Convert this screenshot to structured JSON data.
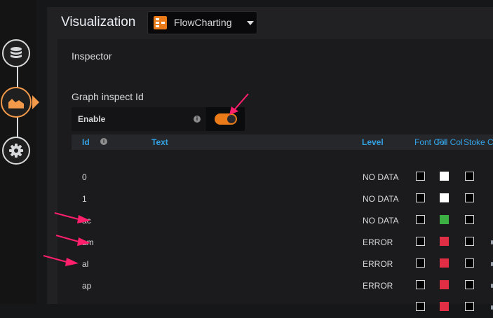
{
  "header": {
    "title": "Visualization",
    "selected_viz": "FlowCharting"
  },
  "rail": {
    "items": [
      "queries",
      "visualization",
      "general-settings"
    ]
  },
  "inspector": {
    "title": "Inspector",
    "subtitle": "Graph inspect Id",
    "enable_label": "Enable",
    "enable_state": true
  },
  "table": {
    "headers": [
      "Id",
      "Text",
      "Level",
      "Font Col",
      "Fill Col",
      "Stoke Col"
    ],
    "rows": [
      {
        "id": "0",
        "level": "NO DATA",
        "font": "#000000",
        "fill": "#ffffff",
        "stroke": "#000000"
      },
      {
        "id": "1",
        "level": "NO DATA",
        "font": "#000000",
        "fill": "#ffffff",
        "stroke": "#000000"
      },
      {
        "id": "ac",
        "level": "NO DATA",
        "font": "#000000",
        "fill": "#3cb043",
        "stroke": "#000000"
      },
      {
        "id": "am",
        "level": "ERROR",
        "font": "#000000",
        "fill": "#e02f44",
        "stroke": "#000000"
      },
      {
        "id": "al",
        "level": "ERROR",
        "font": "#000000",
        "fill": "#e02f44",
        "stroke": "#000000"
      },
      {
        "id": "ap",
        "level": "ERROR",
        "font": "#000000",
        "fill": "#e02f44",
        "stroke": "#000000"
      },
      {
        "id": "",
        "level": "",
        "font": "#000000",
        "fill": "#e02f44",
        "stroke": "#000000"
      }
    ]
  },
  "colors": {
    "accent": "#eb7b18",
    "header_link": "#33a2e5",
    "annotation": "#ff1f6b"
  }
}
